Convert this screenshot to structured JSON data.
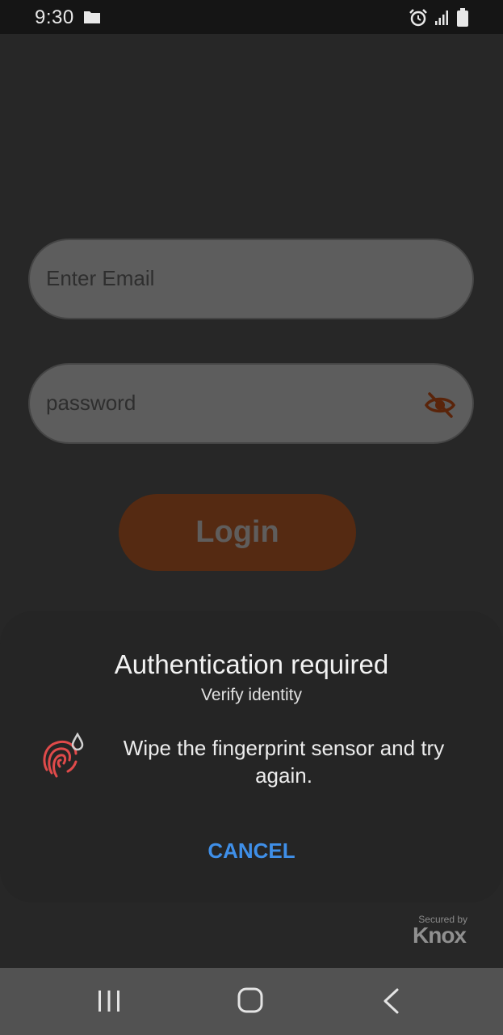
{
  "status_bar": {
    "time": "9:30"
  },
  "form": {
    "email_placeholder": "Enter Email",
    "password_placeholder": "password",
    "login_label": "Login"
  },
  "dialog": {
    "title": "Authentication required",
    "subtitle": "Verify identity",
    "message": "Wipe the fingerprint sensor and try again.",
    "cancel_label": "CANCEL"
  },
  "knox": {
    "secured_by": "Secured by",
    "brand": "Knox"
  },
  "colors": {
    "accent": "#3f8fe8",
    "login_button": "#552a12",
    "fingerprint_error": "#e04a4a"
  }
}
